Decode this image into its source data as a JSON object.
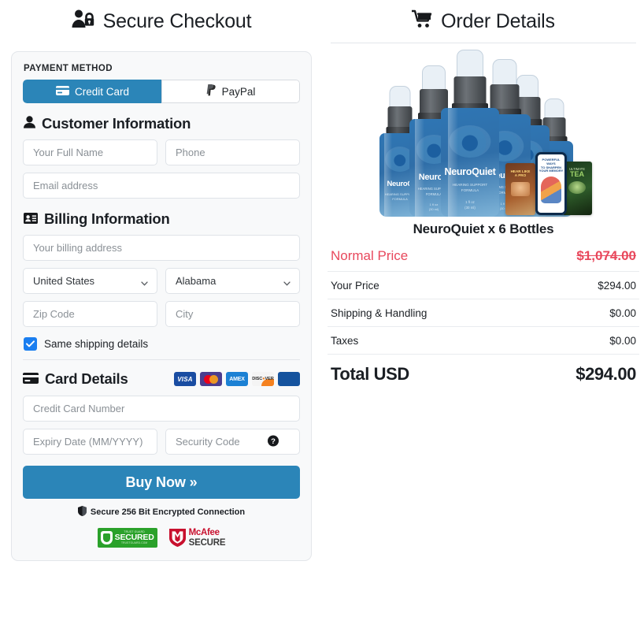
{
  "left": {
    "header": {
      "title": "Secure Checkout",
      "icon": "user-lock-icon"
    },
    "payment_method_label": "PAYMENT METHOD",
    "tabs": [
      {
        "label": "Credit Card",
        "icon": "credit-card-icon",
        "active": true
      },
      {
        "label": "PayPal",
        "icon": "paypal-icon",
        "active": false
      }
    ],
    "customer_section": {
      "heading": "Customer Information",
      "icon": "user-icon",
      "fields": [
        {
          "name": "full-name",
          "placeholder": "Your Full Name",
          "value": ""
        },
        {
          "name": "phone",
          "placeholder": "Phone",
          "value": ""
        },
        {
          "name": "email",
          "placeholder": "Email address",
          "value": ""
        }
      ]
    },
    "billing_section": {
      "heading": "Billing Information",
      "icon": "id-card-icon",
      "address_placeholder": "Your billing address",
      "country": {
        "value": "United States",
        "icon": "chevron-down-icon"
      },
      "state": {
        "value": "Alabama",
        "icon": "chevron-down-icon"
      },
      "zip_placeholder": "Zip Code",
      "city_placeholder": "City",
      "same_shipping": {
        "label": "Same shipping details",
        "checked": true
      }
    },
    "card_section": {
      "heading": "Card Details",
      "icon": "card-icon",
      "brands": [
        "visa",
        "mastercard",
        "amex",
        "discover",
        "jcb"
      ],
      "number_placeholder": "Credit Card Number",
      "expiry_placeholder": "Expiry Date (MM/YYYY)",
      "cvv_placeholder": "Security Code",
      "cvv_help_icon": "question-circle-icon"
    },
    "buy_button": "Buy Now »",
    "secure_note": {
      "text": "Secure 256 Bit Encrypted Connection",
      "icon": "shield-icon"
    },
    "badges": [
      {
        "name": "trust-guard-secured",
        "top": "TRUST GUARD",
        "main": "SECURED",
        "bottom": "TRUSTGUARD.COM"
      },
      {
        "name": "mcafee-secure",
        "line1": "McAfee",
        "line2": "SECURE"
      }
    ]
  },
  "right": {
    "header": {
      "title": "Order Details",
      "icon": "shopping-cart-icon"
    },
    "product": {
      "title": "NeuroQuiet x 6 Bottles",
      "bottle_label": "NeuroQuiet",
      "bottle_sub1": "HEARING SUPPORT",
      "bottle_sub2": "FORMULA",
      "bottle_size1": "1 fl oz",
      "bottle_size2": "(30 ml)",
      "bonus_left": "HEAR LIKE A PRO",
      "bonus_center": "POWERFUL WAYS TO SHARPEN YOUR MEMORY",
      "bonus_right": "ULTIMATE TEA"
    },
    "summary": [
      {
        "label": "Normal Price",
        "value": "$1,074.00",
        "style": "normal"
      },
      {
        "label": "Your Price",
        "value": "$294.00",
        "style": "plain"
      },
      {
        "label": "Shipping & Handling",
        "value": "$0.00",
        "style": "plain"
      },
      {
        "label": "Taxes",
        "value": "$0.00",
        "style": "plain"
      },
      {
        "label": "Total USD",
        "value": "$294.00",
        "style": "total"
      }
    ]
  },
  "colors": {
    "accent_blue": "#2b85b8",
    "checkbox_blue": "#1a7ef0",
    "sale_red": "#e8485c",
    "panel_bg": "#f8f9fa",
    "border": "#e3e6ea"
  }
}
